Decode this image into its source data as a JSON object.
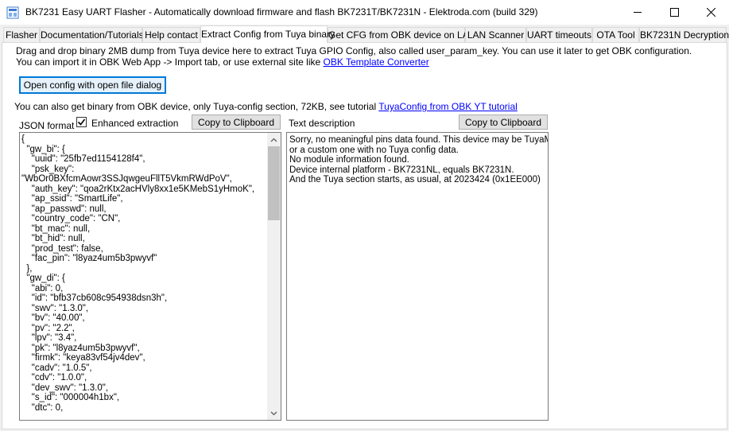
{
  "window": {
    "title": "BK7231 Easy UART Flasher - Automatically download firmware and flash BK7231T/BK7231N  - Elektroda.com (build 329)"
  },
  "tabs": [
    {
      "label": "Flasher"
    },
    {
      "label": "Documentation/Tutorials"
    },
    {
      "label": "Help contact"
    },
    {
      "label": "Extract Config from Tuya binary"
    },
    {
      "label": "Get CFG from OBK device on LAN"
    },
    {
      "label": "LAN Scanner"
    },
    {
      "label": "UART timeouts"
    },
    {
      "label": "OTA Tool"
    },
    {
      "label": "BK7231N Decryption"
    }
  ],
  "panel": {
    "intro_line1": "Drag and drop binary 2MB dump from Tuya device here to extract Tuya GPIO Config, also called user_param_key. You can use it later to get OBK configuration.",
    "intro_line2_prefix": "You can import it in OBK Web App -> Import tab, or use external site like ",
    "intro_line2_link": "OBK Template Converter",
    "open_button": "Open config with open file dialog",
    "obk_line_prefix": "You can also get binary from OBK device, only Tuya-config section, 72KB, see tutorial ",
    "obk_line_link": "TuyaConfig from OBK YT tutorial",
    "json_label": "JSON format",
    "enhanced_label": "Enhanced extraction",
    "enhanced_checked": true,
    "copy_json_button": "Copy to Clipboard",
    "text_desc_label": "Text description",
    "copy_text_button": "Copy to Clipboard",
    "json_text": [
      "{",
      "  \"gw_bi\": {",
      "    \"uuid\": \"25fb7ed1154128f4\",",
      "    \"psk_key\":",
      "\"WbOr0BXfcmAowr3SSJqwgeuFllT5VkmRWdPoV\",",
      "    \"auth_key\": \"qoa2rKtx2acHVly8xx1e5KMebS1yHmoK\",",
      "    \"ap_ssid\": \"SmartLife\",",
      "    \"ap_passwd\": null,",
      "    \"country_code\": \"CN\",",
      "    \"bt_mac\": null,",
      "    \"bt_hid\": null,",
      "    \"prod_test\": false,",
      "    \"fac_pin\": \"l8yaz4um5b3pwyvf\"",
      "  },",
      "  \"gw_di\": {",
      "    \"abi\": 0,",
      "    \"id\": \"bfb37cb608c954938dsn3h\",",
      "    \"swv\": \"1.3.0\",",
      "    \"bv\": \"40.00\",",
      "    \"pv\": \"2.2\",",
      "    \"lpv\": \"3.4\",",
      "    \"pk\": \"l8yaz4um5b3pwyvf\",",
      "    \"firmk\": \"keya83vf54jv4dev\",",
      "    \"cadv\": \"1.0.5\",",
      "    \"cdv\": \"1.0.0\",",
      "    \"dev_swv\": \"1.3.0\",",
      "    \"s_id\": \"000004h1bx\",",
      "    \"dtc\": 0,"
    ],
    "description_text": [
      "Sorry, no meaningful pins data found. This device may be TuyaMCU",
      "or a custom one with no Tuya config data.",
      "No module information found.",
      "Device internal platform - BK7231NL, equals BK7231N.",
      "And the Tuya section starts, as usual, at 2023424 (0x1EE000)"
    ]
  }
}
